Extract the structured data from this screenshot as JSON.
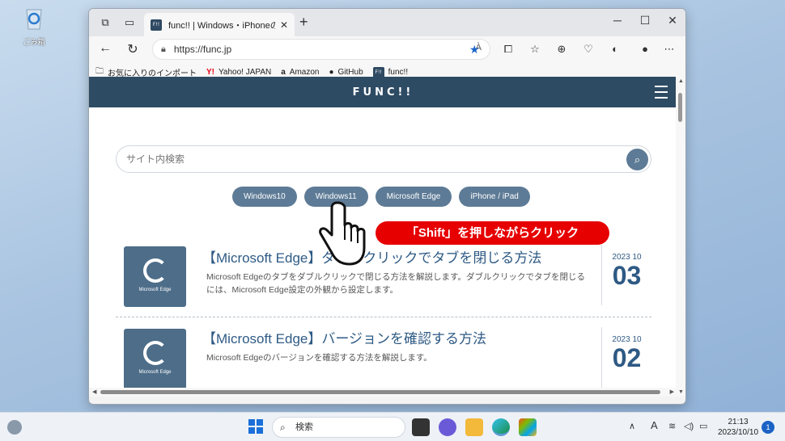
{
  "desktop": {
    "recycle_label": "ごみ箱"
  },
  "browser": {
    "tab_title": "func!! | Windows・iPhoneの使い方",
    "favicon_text": "F!!",
    "url": "https://func.jp",
    "read_aloud": "À",
    "bookmarks": [
      {
        "label": "お気に入りのインポート",
        "icon": "folder-icon"
      },
      {
        "label": "Yahoo! JAPAN",
        "icon": "yahoo-icon"
      },
      {
        "label": "Amazon",
        "icon": "amazon-icon"
      },
      {
        "label": "GitHub",
        "icon": "github-icon"
      },
      {
        "label": "func!!",
        "icon": "func-icon"
      }
    ]
  },
  "site": {
    "logo": "FUNC!!",
    "search_placeholder": "サイト内検索",
    "tags": [
      "Windows10",
      "Windows11",
      "Microsoft Edge",
      "iPhone / iPad"
    ],
    "articles": [
      {
        "title": "【Microsoft Edge】ダブルクリックでタブを閉じる方法",
        "desc": "Microsoft Edgeのタブをダブルクリックで閉じる方法を解説します。ダブルクリックでタブを閉じるには、Microsoft Edge設定の外観から設定します。",
        "thumb_caption": "Microsoft Edge",
        "year_month": "2023 10",
        "day": "03"
      },
      {
        "title": "【Microsoft Edge】バージョンを確認する方法",
        "desc": "Microsoft Edgeのバージョンを確認する方法を解説します。",
        "thumb_caption": "Microsoft Edge",
        "year_month": "2023 10",
        "day": "02"
      }
    ]
  },
  "callout": "「Shift」を押しながらクリック",
  "taskbar": {
    "search_label": "検索",
    "time": "21:13",
    "date": "2023/10/10",
    "notification_count": "1",
    "ime": "A"
  },
  "colors": {
    "header": "#2e4b64",
    "tag": "#5d7b96",
    "callout": "#e60000",
    "title": "#2e5a84"
  }
}
